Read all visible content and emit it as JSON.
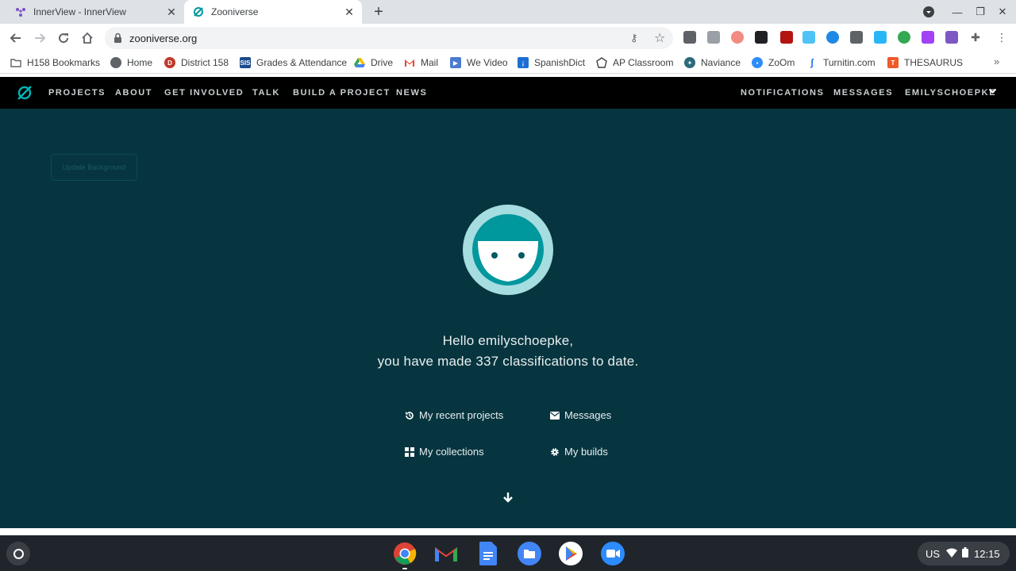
{
  "browser": {
    "tabs": [
      {
        "title": "InnerView - InnerView",
        "active": false
      },
      {
        "title": "Zooniverse",
        "active": true
      }
    ],
    "url": "zooniverse.org",
    "bookmarks": [
      {
        "label": "H158 Bookmarks",
        "icon": "folder-icon",
        "color": "#5f6368"
      },
      {
        "label": "Home",
        "icon": "globe-icon",
        "color": "#5f6368"
      },
      {
        "label": "District 158",
        "icon": "district-logo",
        "color": "#c0392b"
      },
      {
        "label": "Grades & Attendance",
        "icon": "sis-icon",
        "color": "#1a4b8c"
      },
      {
        "label": "Drive",
        "icon": "drive-icon",
        "color": "#fbbc04"
      },
      {
        "label": "Mail",
        "icon": "gmail-icon",
        "color": "#ea4335"
      },
      {
        "label": "We Video",
        "icon": "wevideo-icon",
        "color": "#4a7bd0"
      },
      {
        "label": "SpanishDict",
        "icon": "spanishdict-icon",
        "color": "#1d6fd1"
      },
      {
        "label": "AP Classroom",
        "icon": "ap-icon",
        "color": "#3c4043"
      },
      {
        "label": "Naviance",
        "icon": "naviance-icon",
        "color": "#2b6a7a"
      },
      {
        "label": "ZoOm",
        "icon": "zoom-icon",
        "color": "#2d8cff"
      },
      {
        "label": "Turnitin.com",
        "icon": "turnitin-icon",
        "color": "#1a73e8"
      },
      {
        "label": "THESAURUS",
        "icon": "thesaurus-icon",
        "color": "#f05a28"
      }
    ]
  },
  "zooniverse_nav": {
    "left": [
      "PROJECTS",
      "ABOUT",
      "GET INVOLVED",
      "TALK",
      "BUILD A PROJECT",
      "NEWS"
    ],
    "right": [
      "NOTIFICATIONS",
      "MESSAGES",
      "EMILYSCHOEPKE"
    ]
  },
  "hero": {
    "update_background": "Update Background",
    "greeting_line1": "Hello emilyschoepke,",
    "greeting_line2": "you have made 337 classifications to date.",
    "links": {
      "recent_projects": "My recent projects",
      "messages": "Messages",
      "collections": "My collections",
      "builds": "My builds"
    }
  },
  "shelf": {
    "apps": [
      "chrome-icon",
      "gmail-icon",
      "docs-icon",
      "files-icon",
      "play-store-icon",
      "zoom-icon"
    ],
    "tray": {
      "locale": "US",
      "time": "12:15"
    }
  },
  "colors": {
    "hero_bg": "#06353f",
    "zooniverse_teal": "#00979d",
    "avatar_ring": "#a6dde0"
  }
}
